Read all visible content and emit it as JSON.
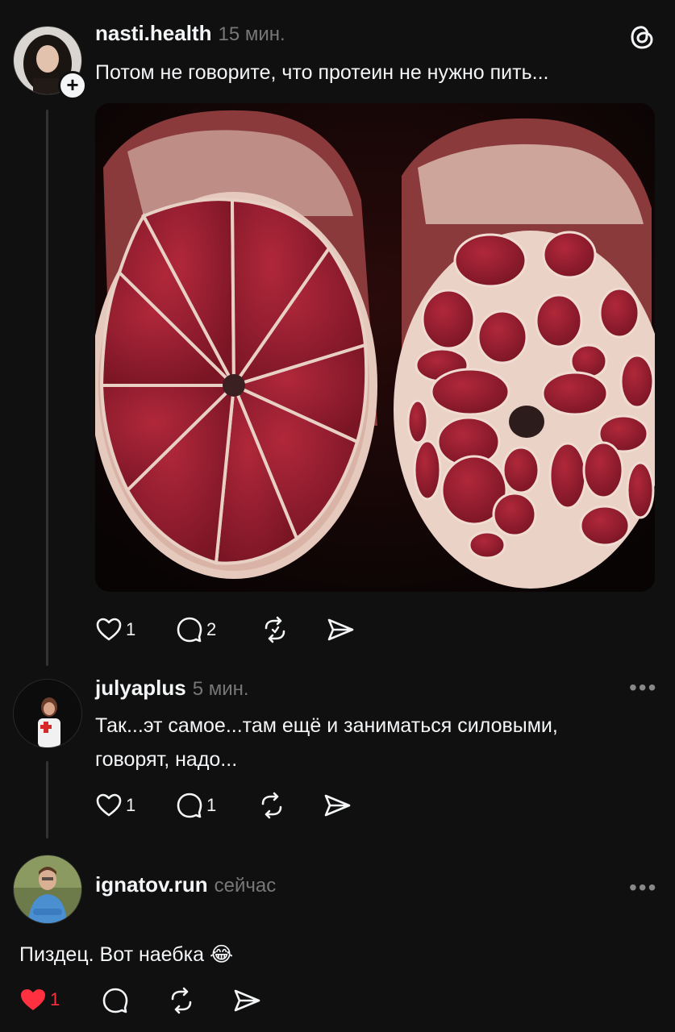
{
  "post": {
    "username": "nasti.health",
    "time": "15 мин.",
    "text": "Потом не говорите, что протеин не нужно пить...",
    "likes": "1",
    "comments": "2"
  },
  "reply1": {
    "username": "julyaplus",
    "time": "5 мин.",
    "text_line1": "Так...эт самое...там ещё и заниматься силовыми,",
    "text_line2": "говорят, надо...",
    "likes": "1",
    "comments": "1"
  },
  "reply2": {
    "username": "ignatov.run",
    "time": "сейчас",
    "text": "Пиздец. Вот наебка 😂",
    "likes": "1"
  },
  "colors": {
    "background": "#101010",
    "text": "#f3f5f7",
    "muted": "#777777",
    "like_active": "#ff3040"
  },
  "icons": [
    "threads-logo-icon",
    "plus-icon",
    "heart-icon",
    "comment-icon",
    "repost-icon",
    "share-icon",
    "more-icon"
  ]
}
